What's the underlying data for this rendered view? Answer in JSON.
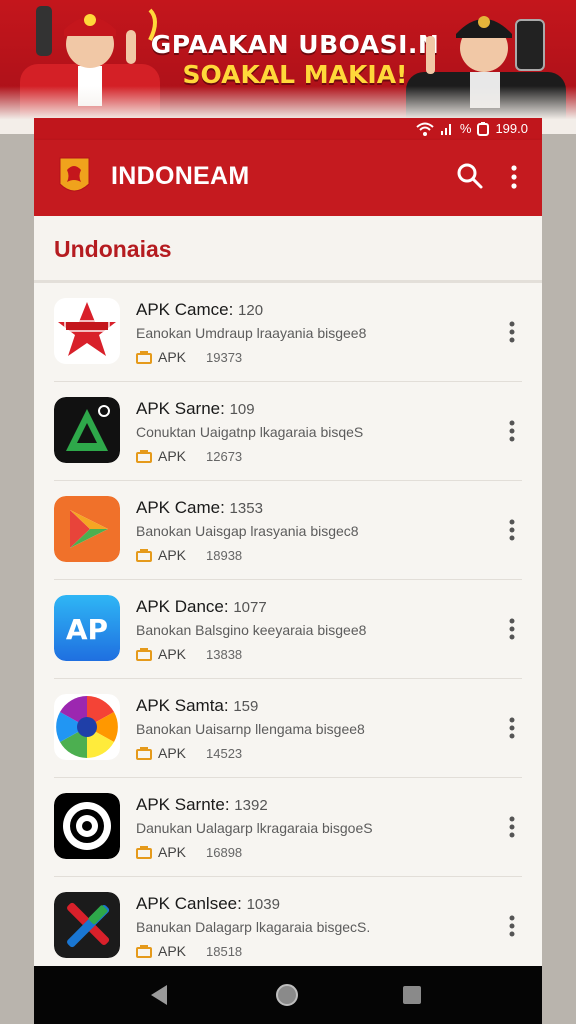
{
  "banner": {
    "line1": "GPAAKAN UBOASI.N",
    "line2": "SOAKAL MAKIA!"
  },
  "statusbar": {
    "battery_text": "%",
    "time": "199.0"
  },
  "appbar": {
    "title": "INDONEAM",
    "logo_icon": "shield-logo-icon",
    "search_icon": "search-icon",
    "more_icon": "more-vertical-icon"
  },
  "section": {
    "title": "Undonaias"
  },
  "items": [
    {
      "title": "APK Camce:",
      "number": "120",
      "desc": "Eanokan Umdraup lraayania bisgee8",
      "tag": "APK",
      "size": "19373",
      "icon": "red-star-icon"
    },
    {
      "title": "APK Sarne:",
      "number": "109",
      "desc": "Conuktan Uaigatnp lkagaraia bisqeS",
      "tag": "APK",
      "size": "12673",
      "icon": "green-a-icon"
    },
    {
      "title": "APK Came:",
      "number": "1353",
      "desc": "Banokan Uaisgap lrasyania bisgec8",
      "tag": "APK",
      "size": "18938",
      "icon": "play-store-icon"
    },
    {
      "title": "APK Dance:",
      "number": "1077",
      "desc": "Banokan Balsgino keeyaraia bisgee8",
      "tag": "APK",
      "size": "13838",
      "icon": "app-store-icon"
    },
    {
      "title": "APK Samta:",
      "number": "159",
      "desc": "Banokan Uaisarnp llengama bisgee8",
      "tag": "APK",
      "size": "14523",
      "icon": "color-wheel-icon"
    },
    {
      "title": "APK Sarnte:",
      "number": "1392",
      "desc": "Danukan Ualagarp lkragaraia bisgoeS",
      "tag": "APK",
      "size": "16898",
      "icon": "target-icon"
    },
    {
      "title": "APK Canlsee:",
      "number": "1039",
      "desc": "Banukan Dalagarp lkagaraia bisgecS.",
      "tag": "APK",
      "size": "18518",
      "icon": "tools-icon"
    }
  ],
  "navbar": {
    "back_icon": "back-triangle-icon",
    "home_icon": "home-circle-icon",
    "recent_icon": "recents-square-icon"
  },
  "colors": {
    "brand_red": "#c51a1f",
    "section_title": "#b51b20",
    "tag_orange": "#e59a1b"
  }
}
